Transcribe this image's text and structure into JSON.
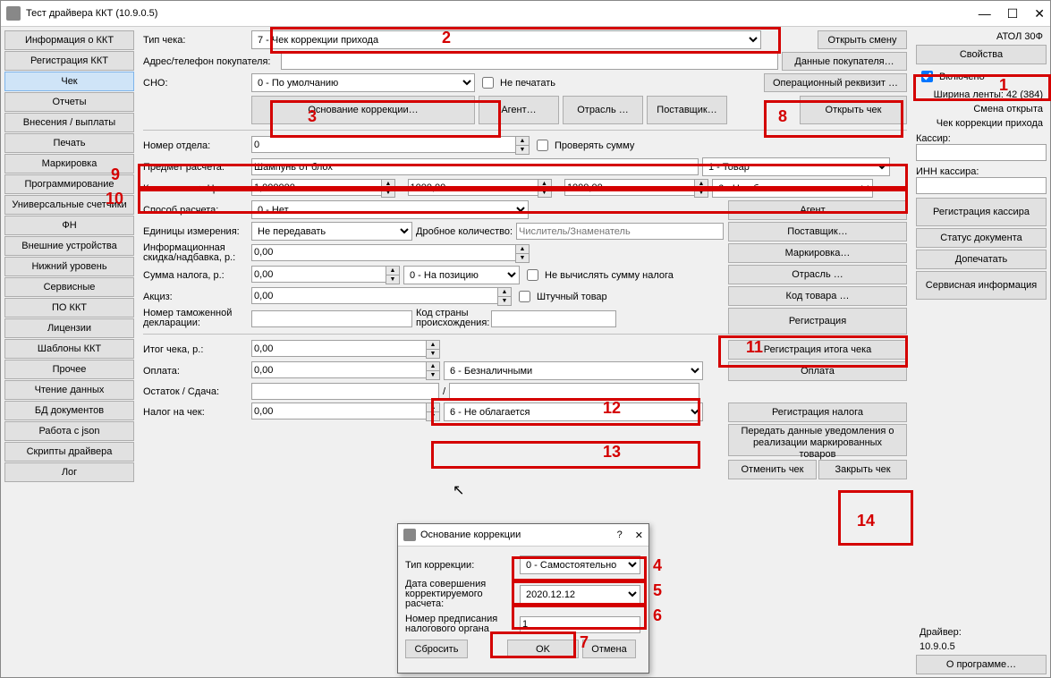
{
  "window": {
    "title": "Тест драйвера ККТ (10.9.0.5)"
  },
  "winbtns": {
    "min": "—",
    "max": "☐",
    "close": "✕"
  },
  "sidebar": {
    "items": [
      "Информация о ККТ",
      "Регистрация ККТ",
      "Чек",
      "Отчеты",
      "Внесения / выплаты",
      "Печать",
      "Маркировка",
      "Программирование",
      "Универсальные счетчики",
      "ФН",
      "Внешние устройства",
      "Нижний уровень",
      "Сервисные",
      "ПО ККТ",
      "Лицензии",
      "Шаблоны ККТ",
      "Прочее",
      "Чтение данных",
      "БД документов",
      "Работа с json",
      "Скрипты драйвера",
      "Лог"
    ],
    "active": 2
  },
  "labels": {
    "chequeType": "Тип чека:",
    "buyer": "Адрес/телефон покупателя:",
    "sno": "СНО:",
    "dept": "Номер отдела:",
    "subject": "Предмет расчета:",
    "qtyprice": "Количество × Цена:",
    "paymethod": "Способ расчета:",
    "unit": "Единицы измерения:",
    "fracqty": "Дробное количество:",
    "infodisc": "Информационная скидка/надбавка, р.:",
    "taxsum": "Сумма налога, р.:",
    "excise": "Акциз:",
    "customs": "Номер таможенной декларации:",
    "origin": "Код страны происхождения:",
    "total": "Итог чека, р.:",
    "payment": "Оплата:",
    "change": "Остаток / Сдача:",
    "taxoncheque": "Налог на чек:",
    "noprint": "Не печатать",
    "checksum": "Проверять сумму",
    "nocalctax": "Не вычислять сумму налога",
    "piece": "Штучный товар"
  },
  "vals": {
    "chequeType": "7 - Чек коррекции прихода",
    "sno": "0 - По умолчанию",
    "dept": "0",
    "subject": "Шампунь от блох",
    "subjectType": "1 - Товар",
    "qty": "1,000000",
    "price": "1000,00",
    "sum": "1000,00",
    "tax": "6 - Не облагается",
    "paymethod": "0 - Нет",
    "unit": "Не передавать",
    "fracqty": "Числитель/Знаменатель",
    "infodisc": "0,00",
    "taxsum": "0,00",
    "taxpos": "0 - На позицию",
    "excise": "0,00",
    "total": "0,00",
    "payment": "0,00",
    "paytype": "6 - Безналичными",
    "change1": "",
    "change2": "",
    "taxoncheque": "0,00",
    "taxtype2": "6 - Не облагается",
    "x": "x",
    "eq": "=",
    "slash": "/"
  },
  "btns": {
    "openShift": "Открыть смену",
    "buyerData": "Данные покупателя…",
    "operReq": "Операционный реквизит …",
    "basis": "Основание коррекции…",
    "agent": "Агент…",
    "industry": "Отрасль …",
    "supplier": "Поставщик…",
    "openCheque": "Открыть чек",
    "agent2": "Агент…",
    "supplier2": "Поставщик…",
    "marking": "Маркировка…",
    "industry2": "Отрасль …",
    "goodscode": "Код товара …",
    "register": "Регистрация",
    "regtotal": "Регистрация итога чека",
    "pay": "Оплата",
    "regtax": "Регистрация налога",
    "senddata": "Передать данные уведомления о реализации маркированных товаров",
    "cancel": "Отменить чек",
    "close": "Закрыть чек"
  },
  "right": {
    "device": "АТОЛ 30Ф",
    "props": "Свойства",
    "enabled": "Включено",
    "width": "Ширина ленты: 42 (384)",
    "shift": "Смена открыта",
    "chequetype": "Чек коррекции прихода",
    "cashier": "Кассир:",
    "cashierinn": "ИНН кассира:",
    "regcashier": "Регистрация кассира",
    "docstatus": "Статус документа",
    "reprint": "Допечатать",
    "service": "Сервисная информация",
    "driver": "Драйвер:",
    "ver": "10.9.0.5",
    "about": "О программе…"
  },
  "dialog": {
    "title": "Основание коррекции",
    "help": "?",
    "close": "✕",
    "type_lbl": "Тип коррекции:",
    "type_val": "0 - Самостоятельно",
    "date_lbl": "Дата совершения корректируемого расчета:",
    "date_val": "2020.12.12",
    "num_lbl": "Номер предписания налогового органа",
    "num_val": "1",
    "reset": "Сбросить",
    "ok": "OK",
    "cancel": "Отмена"
  },
  "marks": {
    "1": "1",
    "2": "2",
    "3": "3",
    "4": "4",
    "5": "5",
    "6": "6",
    "7": "7",
    "8": "8",
    "9": "9",
    "10": "10",
    "11": "11",
    "12": "12",
    "13": "13",
    "14": "14"
  }
}
